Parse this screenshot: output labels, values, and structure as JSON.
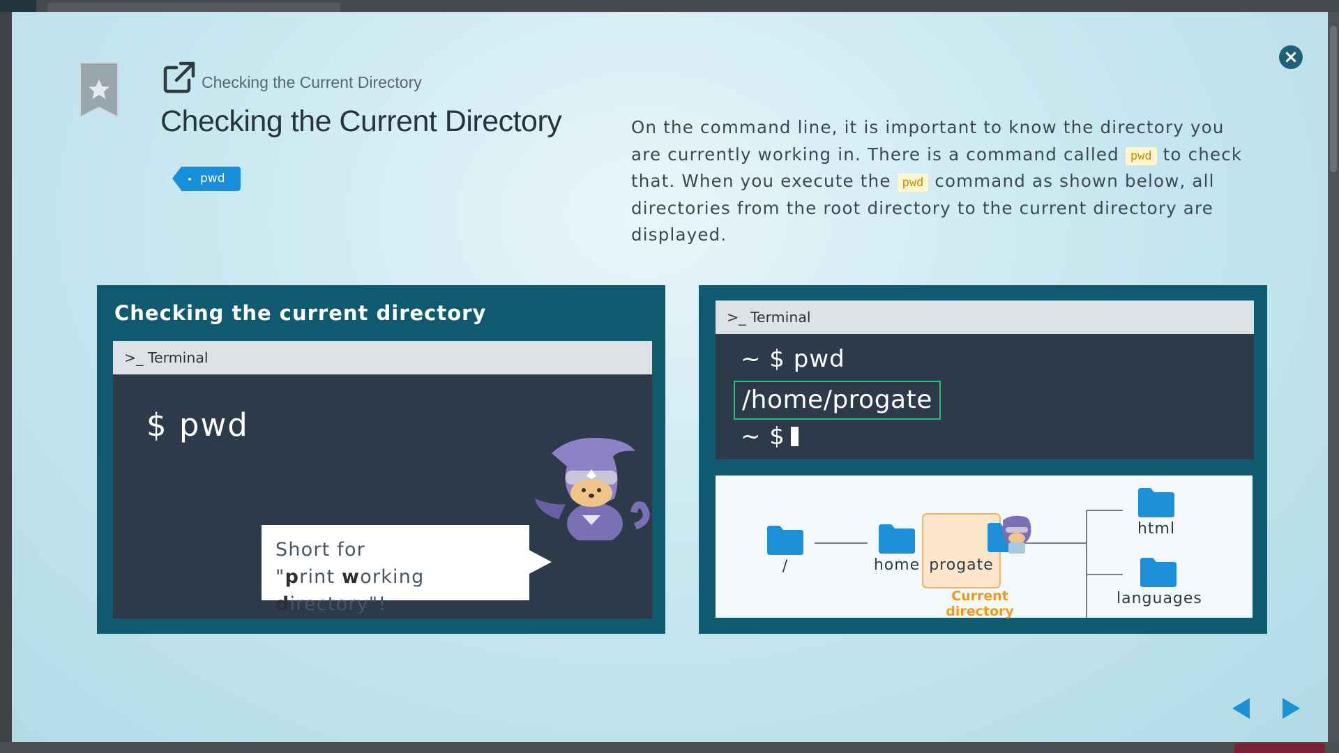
{
  "modal": {
    "breadcrumb": "Checking the Current Directory",
    "title": "Checking the Current Directory",
    "tag": "pwd",
    "description": {
      "part1": "On the command line, it is important to know the directory you are currently working in. There is a command called ",
      "code1": "pwd",
      "part2": " to check that. When you execute the ",
      "code2": "pwd",
      "part3": " command as shown below, all directories from the root directory to the current directory are displayed."
    }
  },
  "slide1": {
    "title": "Checking the current directory",
    "terminal_label": "Terminal",
    "command": "$  pwd",
    "bubble_line1": "Short for",
    "bubble_q1": "\"",
    "bubble_p": "p",
    "bubble_rint": "rint ",
    "bubble_w": "w",
    "bubble_orking": "orking ",
    "bubble_d": "d",
    "bubble_irectory": "irectory\"!"
  },
  "slide2": {
    "terminal_label": "Terminal",
    "line1": "~ $ pwd",
    "output": "/home/progate",
    "line3": "~ $",
    "tree": {
      "root": "/",
      "home": "home",
      "progate": "progate",
      "current_label": "Current directory",
      "html": "html",
      "languages": "languages"
    }
  },
  "colors": {
    "panel": "#105a70",
    "terminal_bg": "#2c3a4a",
    "accent_blue": "#1690d8",
    "highlight_green": "#2fbf71",
    "current_orange": "#f09a1a"
  },
  "icons": [
    "bookmark-star-icon",
    "external-link-icon",
    "close-icon",
    "terminal-prompt-icon",
    "folder-icon",
    "prev-arrow-icon",
    "next-arrow-icon"
  ]
}
